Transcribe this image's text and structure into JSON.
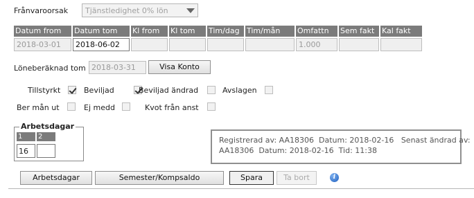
{
  "absence_reason": {
    "label": "Frånvaroorsak",
    "value": "Tjänstledighet 0% lön"
  },
  "table": {
    "headers": [
      "Datum from",
      "Datum tom",
      "Kl from",
      "Kl tom",
      "Tim/dag",
      "Tim/mån",
      "Omfattn",
      "Sem fakt",
      "Kal fakt"
    ],
    "values": [
      "2018-03-01",
      "2018-06-02",
      "",
      "",
      "",
      "",
      "1.000",
      "",
      ""
    ]
  },
  "salary": {
    "label": "Löneberäknad tom",
    "date": "2018-03-31",
    "button": "Visa Konto"
  },
  "checks": {
    "tillstyrkt": {
      "label": "Tillstyrkt",
      "checked": true
    },
    "beviljad": {
      "label": "Beviljad",
      "checked": true
    },
    "beviljad_andrad": {
      "label": "Beviljad ändrad",
      "checked": false
    },
    "avslagen": {
      "label": "Avslagen",
      "checked": false
    },
    "ber_man_ut": {
      "label": "Ber mån ut",
      "checked": false
    },
    "ej_medd": {
      "label": "Ej medd",
      "checked": false
    },
    "kvot_fran_anst": {
      "label": "Kvot från anst",
      "checked": false
    }
  },
  "arbetsdagar": {
    "legend": "Arbetsdagar",
    "col1": "1",
    "col2": "2",
    "val1": "16",
    "val2": ""
  },
  "registered": {
    "line1": "Registrerad av: AA18306  Datum: 2018-02-16   Senast ändrad av:",
    "line2": "AA18306  Datum: 2018-02-16  Tid: 11:38"
  },
  "buttons": {
    "arbetsdagar": "Arbetsdagar",
    "semester": "Semester/Kompsaldo",
    "spara": "Spara",
    "ta_bort": "Ta bort"
  }
}
